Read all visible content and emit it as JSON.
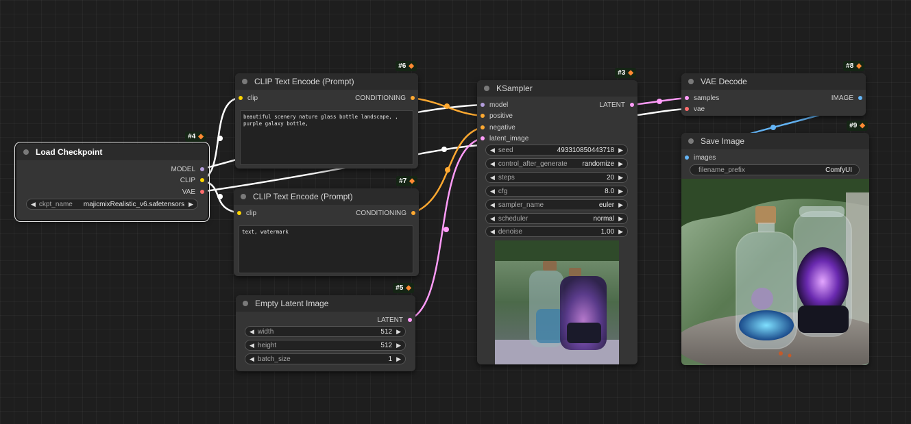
{
  "nodes": {
    "load_checkpoint": {
      "id": "#4",
      "title": "Load Checkpoint",
      "outputs": [
        "MODEL",
        "CLIP",
        "VAE"
      ],
      "widgets": [
        {
          "label": "ckpt_name",
          "value": "majicmixRealistic_v6.safetensors"
        }
      ]
    },
    "clip_pos": {
      "id": "#6",
      "title": "CLIP Text Encode (Prompt)",
      "input": "clip",
      "output": "CONDITIONING",
      "text": "beautiful scenery nature glass bottle landscape, , purple galaxy bottle,"
    },
    "clip_neg": {
      "id": "#7",
      "title": "CLIP Text Encode (Prompt)",
      "input": "clip",
      "output": "CONDITIONING",
      "text": "text, watermark"
    },
    "empty_latent": {
      "id": "#5",
      "title": "Empty Latent Image",
      "output": "LATENT",
      "widgets": [
        {
          "label": "width",
          "value": "512"
        },
        {
          "label": "height",
          "value": "512"
        },
        {
          "label": "batch_size",
          "value": "1"
        }
      ]
    },
    "ksampler": {
      "id": "#3",
      "title": "KSampler",
      "inputs": [
        "model",
        "positive",
        "negative",
        "latent_image"
      ],
      "output": "LATENT",
      "widgets": [
        {
          "label": "seed",
          "value": "493310850443718"
        },
        {
          "label": "control_after_generate",
          "value": "randomize"
        },
        {
          "label": "steps",
          "value": "20"
        },
        {
          "label": "cfg",
          "value": "8.0"
        },
        {
          "label": "sampler_name",
          "value": "euler"
        },
        {
          "label": "scheduler",
          "value": "normal"
        },
        {
          "label": "denoise",
          "value": "1.00"
        }
      ]
    },
    "vae_decode": {
      "id": "#8",
      "title": "VAE Decode",
      "inputs": [
        "samples",
        "vae"
      ],
      "output": "IMAGE"
    },
    "save_image": {
      "id": "#9",
      "title": "Save Image",
      "input": "images",
      "widgets": [
        {
          "label": "filename_prefix",
          "value": "ComfyUI"
        }
      ]
    }
  },
  "colors": {
    "model": "#b39ddb",
    "clip": "#ffd500",
    "vae": "#ff6e6e",
    "conditioning": "#ffa931",
    "latent": "#ff9cf9",
    "image": "#64b5f6"
  },
  "icons": {
    "badge": "fox-icon",
    "node": "collapse-dot-icon",
    "widget_left": "arrow-left-icon",
    "widget_right": "arrow-right-icon"
  }
}
